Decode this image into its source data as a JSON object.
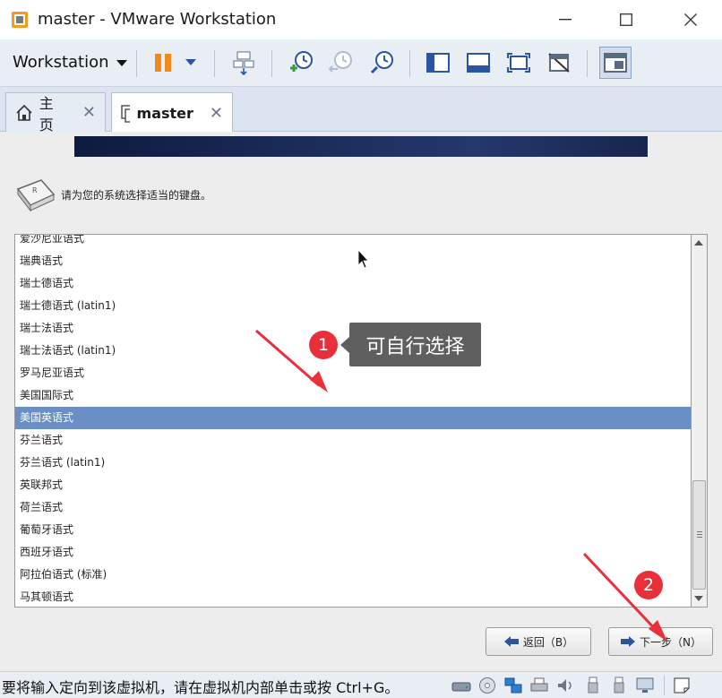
{
  "window": {
    "title": "master - VMware Workstation",
    "minimize_glyph": "—",
    "maximize_glyph": "☐",
    "close_glyph": "✕"
  },
  "toolbar": {
    "menu_label": "Workstation",
    "icons": [
      "pause-icon",
      "dropdown-icon",
      "send-ctrl-alt-del-icon",
      "take-snapshot-icon",
      "revert-snapshot-icon",
      "manage-snapshots-icon",
      "show-library-icon",
      "thumbnail-bar-icon",
      "full-screen-icon",
      "unity-icon",
      "console-view-icon"
    ]
  },
  "tabs": [
    {
      "label": "主页",
      "icon": "home-icon",
      "close": "✕"
    },
    {
      "label": "master",
      "icon": "vm-icon",
      "close": "✕"
    }
  ],
  "installer": {
    "prompt": "请为您的系统选择适当的键盘。",
    "keyboard_layouts": [
      "爱沙尼亚语式",
      "瑞典语式",
      "瑞士德语式",
      "瑞士德语式 (latin1)",
      "瑞士法语式",
      "瑞士法语式 (latin1)",
      "罗马尼亚语式",
      "美国国际式",
      "美国英语式",
      "芬兰语式",
      "芬兰语式 (latin1)",
      "英联邦式",
      "荷兰语式",
      "葡萄牙语式",
      "西班牙语式",
      "阿拉伯语式 (标准)",
      "马其顿语式"
    ],
    "selected_layout": "美国英语式",
    "back_button": "返回（B）",
    "next_button": "下一步（N）"
  },
  "annotations": {
    "badge_1": "1",
    "badge_2": "2",
    "tooltip": "可自行选择",
    "accent_color": "#e8303a"
  },
  "statusbar": {
    "message": "要将输入定向到该虚拟机，请在虚拟机内部单击或按 Ctrl+G。",
    "devices": [
      "hard-disk-icon",
      "cd-dvd-icon",
      "network-adapter-icon",
      "printer-icon",
      "sound-card-icon",
      "usb-icon",
      "usb-icon",
      "display-icon",
      "message-log-icon"
    ]
  },
  "colors": {
    "selection": "#6a8fc4",
    "toolbar_bg": "#e9eef5",
    "banner": "#1c2e5c"
  }
}
